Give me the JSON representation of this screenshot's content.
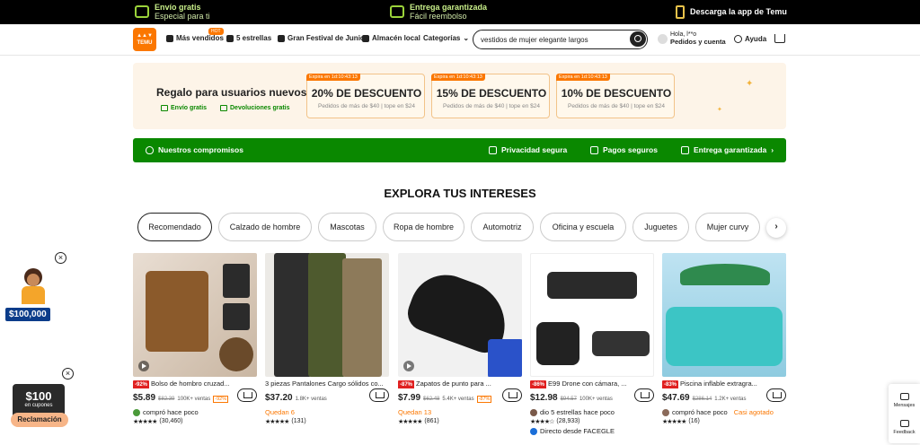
{
  "topbar": {
    "free_shipping_title": "Envío gratis",
    "free_shipping_sub": "Especial para ti",
    "guaranteed_title": "Entrega garantizada",
    "guaranteed_sub": "Fácil reembolso",
    "app_download": "Descarga la app de Temu"
  },
  "header": {
    "logo_text": "TEMU",
    "hot_badge": "HOT",
    "nav": [
      "Más vendidos",
      "5 estrellas",
      "Gran Festival de Junio",
      "Almacén local",
      "Categorías"
    ],
    "search_value": "vestidos de mujer elegante largos",
    "account_greeting": "Hola, l**o",
    "account_orders": "Pedidos y cuenta",
    "help": "Ayuda"
  },
  "promo": {
    "title": "Regalo para usuarios nuevos",
    "feature1": "Envío gratis",
    "feature2": "Devoluciones gratis",
    "coupons": [
      {
        "expiry": "Expira en 1d:10:43:13",
        "discount": "20% DE DESCUENTO",
        "condition": "Pedidos de más de $40 | tope en $24"
      },
      {
        "expiry": "Expira en 1d:10:43:13",
        "discount": "15% DE DESCUENTO",
        "condition": "Pedidos de más de $40 | tope en $24"
      },
      {
        "expiry": "Expira en 1d:10:43:13",
        "discount": "10% DE DESCUENTO",
        "condition": "Pedidos de más de $40 | tope en $24"
      }
    ]
  },
  "commitments": {
    "title": "Nuestros compromisos",
    "privacy": "Privacidad segura",
    "payments": "Pagos seguros",
    "delivery": "Entrega garantizada"
  },
  "section_title": "EXPLORA TUS INTERESES",
  "categories": [
    "Recomendado",
    "Calzado de hombre",
    "Mascotas",
    "Ropa de hombre",
    "Automotriz",
    "Oficina y escuela",
    "Juguetes",
    "Mujer curvy"
  ],
  "products": [
    {
      "badge": "-92%",
      "title": "Bolso de hombro cruzad...",
      "price": "$5.89",
      "old_price": "$82.39",
      "sold": "100K+ ventas",
      "discount": "-92%",
      "meta": "compró hace poco",
      "stars": "★★★★★",
      "reviews": "(30,460)"
    },
    {
      "badge": "",
      "title": "3 piezas Pantalones Cargo sólidos co...",
      "price": "$37.20",
      "old_price": "",
      "sold": "1.8K+ ventas",
      "discount": "",
      "meta": "Quedan 6",
      "stars": "★★★★★",
      "reviews": "(131)"
    },
    {
      "badge": "-87%",
      "title": "Zapatos de punto para ...",
      "price": "$7.99",
      "old_price": "$62.48",
      "sold": "5.4K+ ventas",
      "discount": "-87%",
      "meta": "Quedan 13",
      "stars": "★★★★★",
      "reviews": "(861)"
    },
    {
      "badge": "-86%",
      "title": "E99 Drone con cámara, ...",
      "price": "$12.98",
      "old_price": "$94.57",
      "sold": "100K+ ventas",
      "discount": "",
      "meta": "dio 5 estrellas hace poco",
      "stars": "★★★★☆",
      "reviews": "(28,933)",
      "direct": "Directo desde FACEGLE"
    },
    {
      "badge": "-83%",
      "title": "Piscina inflable extragra...",
      "price": "$47.69",
      "old_price": "$286.14",
      "sold": "1.2K+ ventas",
      "discount": "",
      "meta": "compró hace poco",
      "meta2": "Casi agotado",
      "stars": "★★★★★",
      "reviews": "(16)"
    }
  ],
  "float_cash": "$100,000",
  "float_coupon_amount": "$100",
  "float_coupon_sub": "en cupones",
  "float_claim": "Reclamación",
  "side": {
    "messages": "Mensajes",
    "feedback": "Feedback"
  },
  "colors": {
    "brand": "#fb7701",
    "green": "#0a8800",
    "topbar": "#000000"
  }
}
